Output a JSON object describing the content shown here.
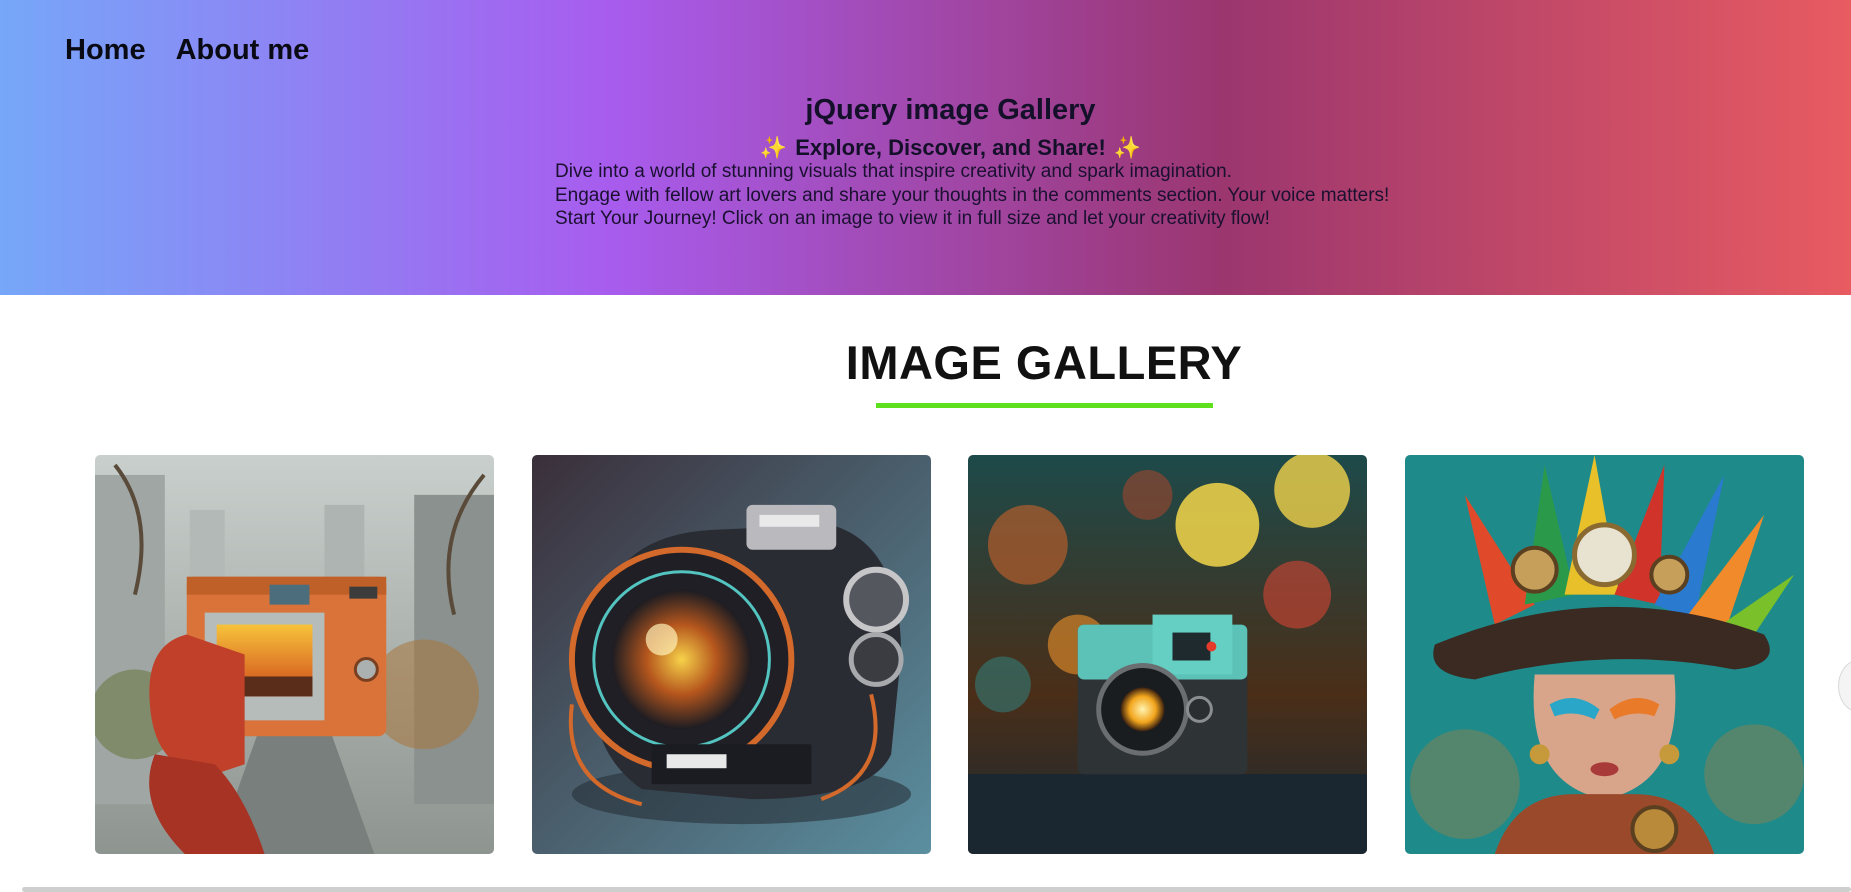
{
  "nav": {
    "home_label": "Home",
    "about_label": "About me"
  },
  "hero": {
    "title": "jQuery image Gallery",
    "subtitle": "Explore, Discover, and Share!",
    "sparkle_glyph": "✨",
    "lines": [
      "Dive into a world of stunning visuals that inspire creativity and spark imagination.",
      "Engage with fellow art lovers and share your thoughts in the comments section. Your voice matters!",
      "Start Your Journey! Click on an image to view it in full size and let your creativity flow!"
    ]
  },
  "gallery": {
    "heading": "IMAGE GALLERY",
    "accent_color": "#5fe01e",
    "images": [
      {
        "subject": "hand holding orange retro camera on rainy city street"
      },
      {
        "subject": "futuristic camera with glowing lens"
      },
      {
        "subject": "teal vintage camera against bokeh lights"
      },
      {
        "subject": "woman with feathered steampunk hat and face paint"
      }
    ]
  },
  "colors": {
    "hero_gradient": [
      "#76a7f9",
      "#a85cee",
      "#9b366f",
      "#e85b61"
    ]
  }
}
